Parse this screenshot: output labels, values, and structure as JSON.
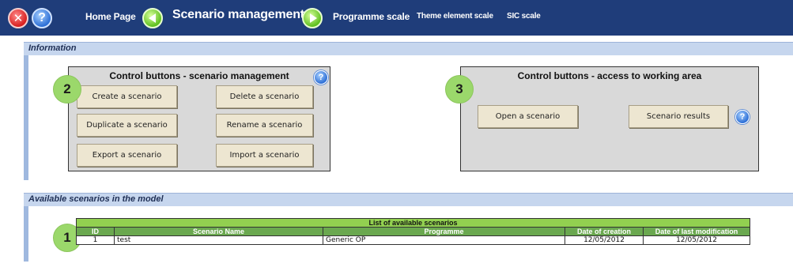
{
  "topbar": {
    "home_label": "Home Page",
    "current_page": "Scenario management",
    "programme_scale": "Programme scale",
    "theme_element_scale": "Theme element scale",
    "sic_scale": "SIC scale",
    "close_glyph": "✕",
    "help_glyph": "?",
    "bar_color": "#1f3d7a"
  },
  "information": {
    "header": "Information",
    "management_panel": {
      "badge": "2",
      "title": "Control buttons - scenario management",
      "help_glyph": "?",
      "buttons": {
        "create": "Create a scenario",
        "delete": "Delete a scenario",
        "duplicate": "Duplicate a scenario",
        "rename": "Rename a scenario",
        "export": "Export a scenario",
        "import": "Import a scenario"
      }
    },
    "access_panel": {
      "badge": "3",
      "title": "Control buttons  - access to working area",
      "help_glyph": "?",
      "buttons": {
        "open": "Open a scenario",
        "results": "Scenario results"
      }
    }
  },
  "available": {
    "header": "Available scenarios in the model",
    "badge": "1",
    "table": {
      "caption": "List of available scenarios",
      "columns": [
        "ID",
        "Scenario Name",
        "Programme",
        "Date of creation",
        "Date of last modification"
      ],
      "rows": [
        [
          "1",
          "test",
          "Generic OP",
          "12/05/2012",
          "12/05/2012"
        ]
      ],
      "header_color": "#6aa84f",
      "caption_color": "#92d050"
    }
  }
}
